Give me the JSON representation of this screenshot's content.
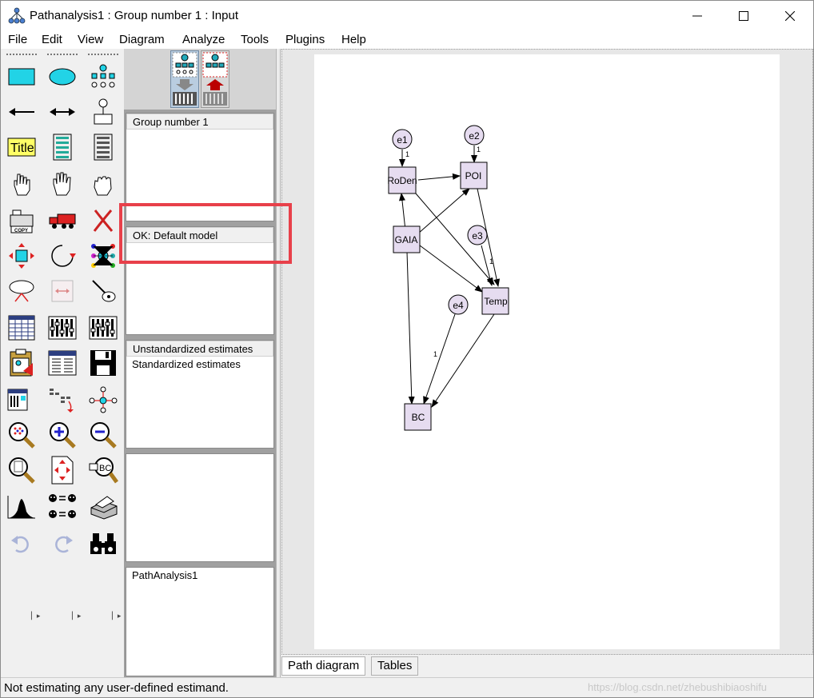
{
  "window": {
    "title": "Pathanalysis1 : Group number 1 : Input"
  },
  "menu": [
    "File",
    "Edit",
    "View",
    "Diagram",
    "Analyze",
    "Tools",
    "Plugins",
    "Help"
  ],
  "toolbox": {
    "tools": [
      "draw-observed-variable-icon",
      "draw-unobserved-variable-icon",
      "draw-latent-indicator-icon",
      "draw-path-icon",
      "draw-covariance-icon",
      "add-unique-variable-icon",
      "figure-caption-icon",
      "list-variables-in-model-icon",
      "list-variables-in-dataset-icon",
      "select-one-object-icon",
      "select-all-objects-icon",
      "deselect-all-objects-icon",
      "duplicate-objects-icon",
      "move-objects-icon",
      "erase-objects-icon",
      "change-shape-icon",
      "rotate-indicators-icon",
      "reflect-indicators-icon",
      "move-parameters-icon",
      "scroll-diagram-icon",
      "touch-up-variable-icon",
      "select-data-files-icon",
      "analysis-properties-icon",
      "calculate-estimates-icon",
      "copy-to-clipboard-icon",
      "view-text-icon",
      "save-diagram-icon",
      "object-properties-icon",
      "drag-properties-icon",
      "preserve-symmetries-icon",
      "zoom-in-area-icon",
      "zoom-in-icon",
      "zoom-out-icon",
      "zoom-page-icon",
      "resize-diagram-to-fit-icon",
      "loupe-icon",
      "bayesian-estimation-icon",
      "multiple-group-analysis-icon",
      "print-diagram-icon",
      "undo-icon",
      "redo-icon",
      "specification-search-icon"
    ],
    "title_tool_label": "Title"
  },
  "groups_panel": {
    "items": [
      "Group number 1"
    ]
  },
  "models_panel": {
    "items": [
      "OK: Default model"
    ]
  },
  "estimates_panel": {
    "items": [
      "Unstandardized estimates",
      "Standardized estimates"
    ]
  },
  "files_panel": {
    "items": [
      "PathAnalysis1"
    ]
  },
  "diagram": {
    "nodes": [
      "RoDen",
      "POI",
      "GAIA",
      "Temp",
      "BC"
    ],
    "errors": [
      "e1",
      "e2",
      "e3",
      "e4"
    ],
    "weights": [
      "1",
      "1",
      "1",
      "1"
    ]
  },
  "tabs": [
    "Path diagram",
    "Tables"
  ],
  "status": "Not estimating any user-defined estimand.",
  "watermark": "https://blog.csdn.net/zhebushibiaoshifu",
  "colors": {
    "node_fill": "#e6dcf0",
    "highlight": "#e8404a",
    "tool_cyan": "#22d3e6"
  }
}
